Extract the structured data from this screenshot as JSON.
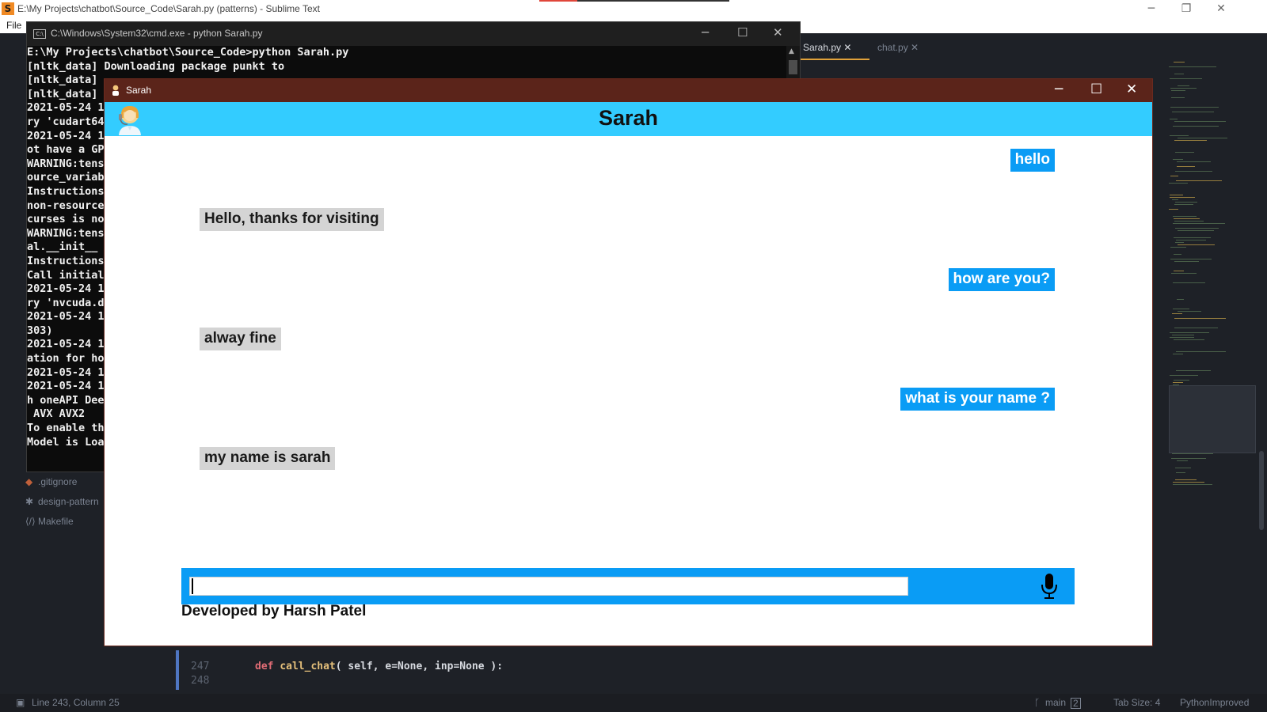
{
  "sublime": {
    "title": "E:\\My Projects\\chatbot\\Source_Code\\Sarah.py (patterns) - Sublime Text",
    "menu_file": "File",
    "tabs": [
      "Sarah.py",
      "chat.py"
    ],
    "sidebar_files": [
      ".gitignore",
      "design-pattern",
      "Makefile"
    ],
    "line_numbers": [
      "247",
      "248"
    ],
    "code": {
      "def": "def",
      "fn": "call_chat",
      "args": "( self, e=None, inp=None ):"
    },
    "status": {
      "position": "Line 243, Column 25",
      "branch": "main",
      "branch_count": "2",
      "tab_size": "Tab Size: 4",
      "syntax": "PythonImproved"
    }
  },
  "cmd": {
    "title": "C:\\Windows\\System32\\cmd.exe - python  Sarah.py",
    "lines": [
      "E:\\My Projects\\chatbot\\Source_Code>python Sarah.py",
      "[nltk_data] Downloading package punkt to",
      "[nltk_data]",
      "[nltk_data]",
      "2021-05-24 1",
      "ry 'cudart64",
      "2021-05-24 1",
      "ot have a GP",
      "WARNING:tens",
      "ource_variab",
      "Instructions",
      "non-resource",
      "curses is no",
      "WARNING:tens",
      "al.__init__",
      "Instructions",
      "Call initial",
      "2021-05-24 1",
      "ry 'nvcuda.d",
      "2021-05-24 1",
      "303)",
      "2021-05-24 1",
      "ation for ho",
      "2021-05-24 1",
      "2021-05-24 1",
      "h oneAPI Dee",
      " AVX AVX2",
      "To enable th",
      "Model is Loa"
    ]
  },
  "sarah": {
    "window_title": "Sarah",
    "header_name": "Sarah",
    "messages": [
      {
        "from": "user",
        "text": "hello"
      },
      {
        "from": "bot",
        "text": "Hello, thanks for visiting"
      },
      {
        "from": "user",
        "text": "how are you?"
      },
      {
        "from": "bot",
        "text": "alway fine"
      },
      {
        "from": "user",
        "text": "what is your name ?"
      },
      {
        "from": "bot",
        "text": "my name is sarah"
      }
    ],
    "input_value": "",
    "credit": "Developed by Harsh Patel",
    "colors": {
      "header": "#33ccff",
      "user_bubble": "#0a9cf5",
      "bot_bubble": "#d4d4d4",
      "titlebar": "#5b241a"
    }
  }
}
